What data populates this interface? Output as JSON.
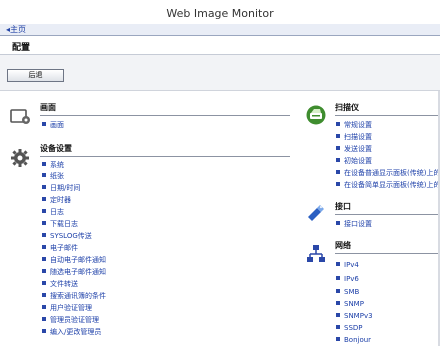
{
  "window": {
    "title": "Web Image Monitor"
  },
  "breadcrumb": {
    "home": "◂主页"
  },
  "page": {
    "title": "配置",
    "back_label": "后退"
  },
  "left_sections": [
    {
      "id": "screen",
      "icon": "screen-settings-icon",
      "title": "画面",
      "items": [
        "画面"
      ]
    },
    {
      "id": "device",
      "icon": "gear-icon",
      "title": "设备设置",
      "items": [
        "系统",
        "纸张",
        "日期/时间",
        "定时器",
        "日志",
        "下载日志",
        "SYSLOG传送",
        "电子邮件",
        "自动电子邮件通知",
        "随选电子邮件通知",
        "文件转送",
        "搜索通讯簿的条件",
        "用户验证管理",
        "管理员验证管理",
        "编入/更改管理员"
      ]
    }
  ],
  "right_sections": [
    {
      "id": "scanner",
      "icon": "scanner-icon",
      "title": "扫描仪",
      "items": [
        "常规设置",
        "扫描设置",
        "发送设置",
        "初始设置",
        "在设备普通显示面板(传统)上的",
        "在设备简单显示面板(传统)上的"
      ]
    },
    {
      "id": "interface",
      "icon": "usb-port-icon",
      "title": "接口",
      "items": [
        "接口设置"
      ]
    },
    {
      "id": "network",
      "icon": "network-icon",
      "title": "网络",
      "items": [
        "IPv4",
        "IPv6",
        "SMB",
        "SNMP",
        "SNMPv3",
        "SSDP",
        "Bonjour"
      ]
    }
  ],
  "colors": {
    "link": "#1c3fa8",
    "bullet": "#2a47a8",
    "accent_green": "#3f8d2f",
    "accent_blue": "#2a5fc2"
  }
}
